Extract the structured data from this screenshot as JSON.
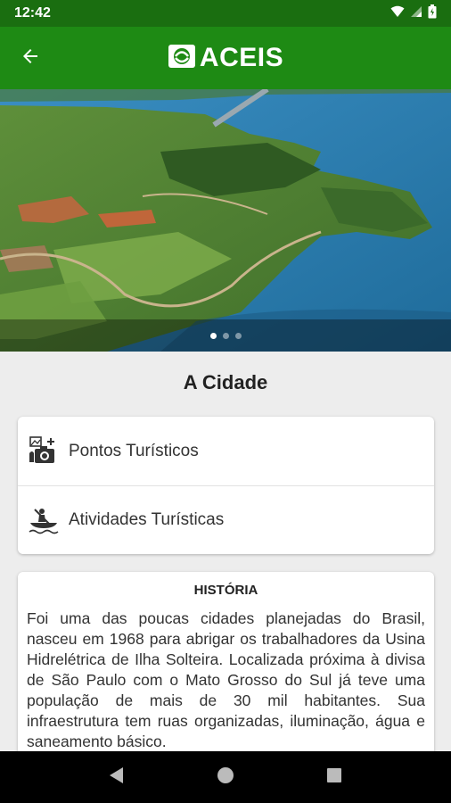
{
  "status_bar": {
    "time": "12:42"
  },
  "app_bar": {
    "brand": "ACEIS",
    "back_icon": "arrow-back-icon"
  },
  "hero": {
    "slides": 3,
    "active_slide": 1
  },
  "section": {
    "title": "A Cidade"
  },
  "menu": {
    "items": [
      {
        "label": "Pontos Turísticos",
        "icon": "camera-landmarks-icon"
      },
      {
        "label": "Atividades Turísticas",
        "icon": "canoe-icon"
      }
    ]
  },
  "history": {
    "title": "HISTÓRIA",
    "text": "Foi uma das poucas cidades planejadas do Brasil, nasceu em 1968 para abrigar os trabalhadores da Usina Hidrelétrica de Ilha Solteira. Localizada próxima à divisa de São Paulo com o Mato Grosso do Sul já teve uma população de mais de 30 mil habitantes. Sua infraestrutura tem ruas organizadas, iluminação, água e saneamento básico."
  },
  "colors": {
    "status_bar": "#1a6e10",
    "app_bar": "#1e8a14",
    "background": "#ededed"
  }
}
